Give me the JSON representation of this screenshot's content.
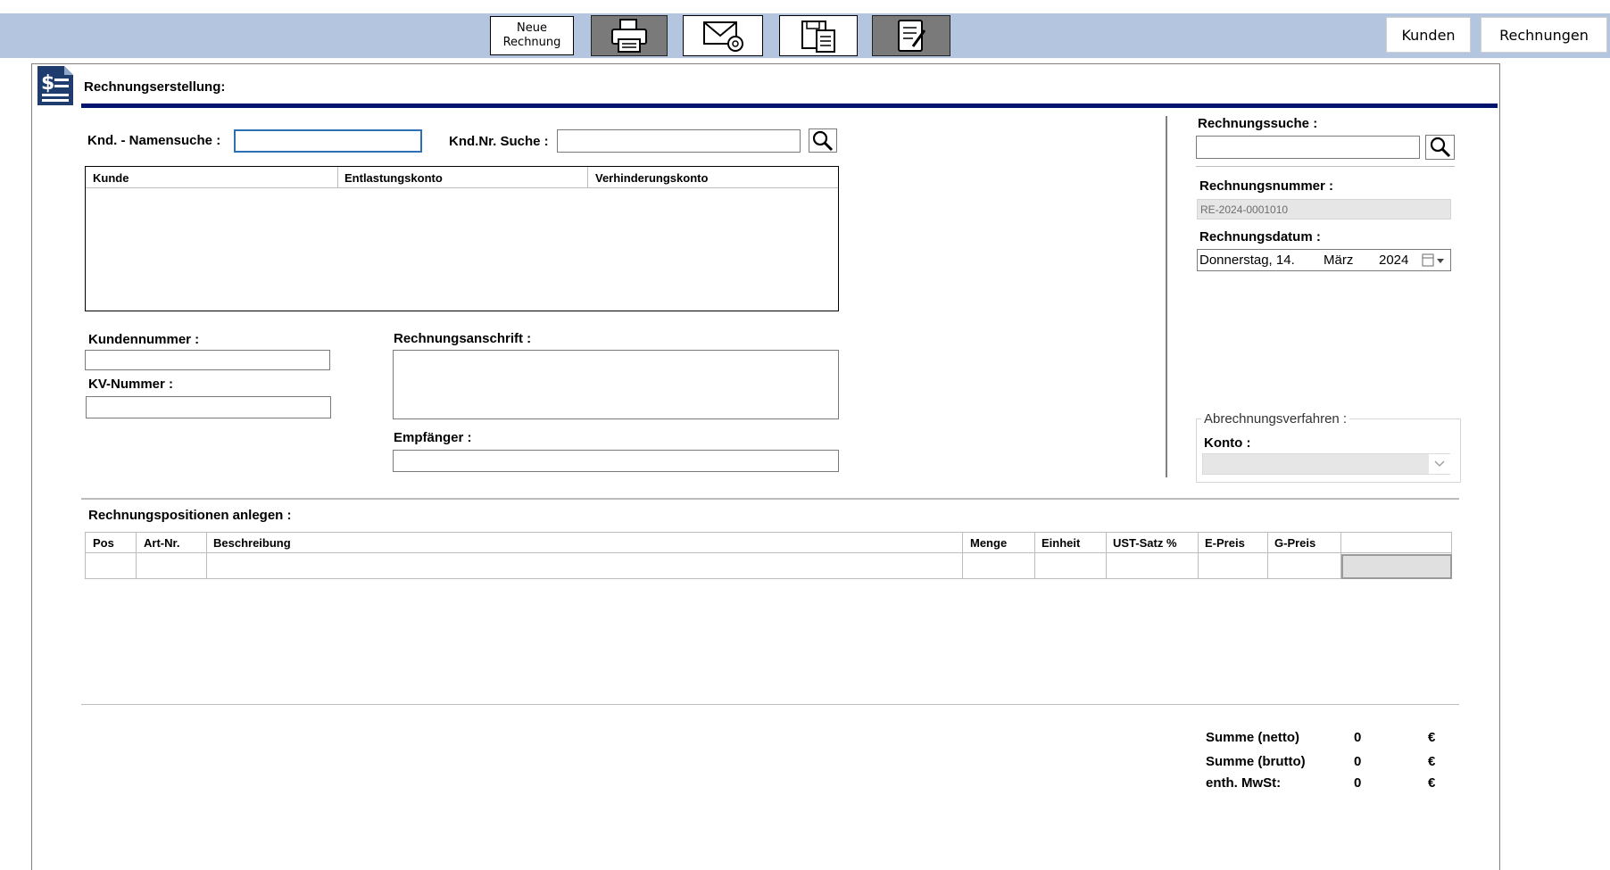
{
  "toolbar": {
    "new_invoice_line1": "Neue",
    "new_invoice_line2": "Rechnung",
    "icons": [
      "printer-icon",
      "mail-icon",
      "save-document-icon",
      "edit-document-icon"
    ]
  },
  "nav": {
    "customers": "Kunden",
    "invoices": "Rechnungen"
  },
  "header": {
    "title": "Rechnungserstellung:"
  },
  "customer_search": {
    "name_label": "Knd. - Namensuche :",
    "number_label": "Knd.Nr. Suche :",
    "name_value": "",
    "number_value": ""
  },
  "customer_table": {
    "columns": [
      "Kunde",
      "Entlastungskonto",
      "Verhinderungskonto"
    ]
  },
  "customer_fields": {
    "customer_number_label": "Kundennummer :",
    "kv_number_label": "KV-Nummer :",
    "billing_address_label": "Rechnungsanschrift :",
    "recipient_label": "Empfänger :"
  },
  "invoice_search": {
    "label": "Rechnungssuche :",
    "value": ""
  },
  "invoice_meta": {
    "number_label": "Rechnungsnummer :",
    "number_value": "RE-2024-0001010",
    "date_label": "Rechnungsdatum :",
    "date_weekday": "Donnerstag, 14.",
    "date_month": "März",
    "date_year": "2024"
  },
  "billing_method": {
    "group_label": "Abrechnungsverfahren :",
    "account_label": "Konto :",
    "account_value": ""
  },
  "positions": {
    "title": "Rechnungspositionen anlegen :",
    "columns": [
      "Pos",
      "Art-Nr.",
      "Beschreibung",
      "Menge",
      "Einheit",
      "UST-Satz %",
      "E-Preis",
      "G-Preis"
    ]
  },
  "totals": {
    "net_label": "Summe (netto)",
    "net_value": "0",
    "gross_label": "Summe (brutto)",
    "gross_value": "0",
    "vat_label": "enth. MwSt:",
    "vat_value": "0",
    "currency": "€"
  },
  "colors": {
    "topbar": "#b4c6df",
    "accent_line": "#00146e",
    "doc_icon": "#1f3c6e"
  }
}
